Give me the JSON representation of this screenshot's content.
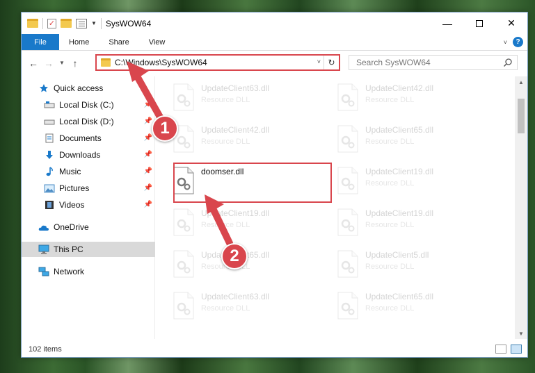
{
  "window": {
    "title": "SysWOW64"
  },
  "window_controls": {
    "minimize": "—",
    "maximize": "",
    "close": "✕"
  },
  "ribbon": {
    "tabs": [
      {
        "label": "File"
      },
      {
        "label": "Home"
      },
      {
        "label": "Share"
      },
      {
        "label": "View"
      }
    ]
  },
  "address": {
    "path": "C:\\Windows\\SysWOW64"
  },
  "search": {
    "placeholder": "Search SysWOW64"
  },
  "navigation": {
    "items": [
      {
        "label": "Quick access",
        "icon": "star-icon"
      },
      {
        "label": "Local Disk (C:)",
        "icon": "drive-icon",
        "pinned": true
      },
      {
        "label": "Local Disk (D:)",
        "icon": "drive-icon",
        "pinned": true
      },
      {
        "label": "Documents",
        "icon": "documents-icon",
        "pinned": true
      },
      {
        "label": "Downloads",
        "icon": "download-arrow-icon",
        "pinned": true
      },
      {
        "label": "Music",
        "icon": "music-note-icon",
        "pinned": true
      },
      {
        "label": "Pictures",
        "icon": "pictures-icon",
        "pinned": true
      },
      {
        "label": "Videos",
        "icon": "film-icon",
        "pinned": true
      },
      {
        "label": "OneDrive",
        "icon": "cloud-icon"
      },
      {
        "label": "This PC",
        "icon": "monitor-icon",
        "selected": true
      },
      {
        "label": "Network",
        "icon": "network-icon"
      }
    ]
  },
  "files": {
    "left": [
      {
        "name": "UpdateClient63.dll",
        "type": "Resource DLL",
        "faded": true
      },
      {
        "name": "UpdateClient42.dll",
        "type": "Resource DLL",
        "faded": true
      },
      {
        "name": "doomser.dll",
        "type": "",
        "faded": false,
        "highlighted": true
      },
      {
        "name": "UpdateClient19.dll",
        "type": "Resource DLL",
        "faded": true
      },
      {
        "name": "UpdateClient65.dll",
        "type": "Resource DLL",
        "faded": true
      },
      {
        "name": "UpdateClient63.dll",
        "type": "Resource DLL",
        "faded": true
      }
    ],
    "right": [
      {
        "name": "UpdateClient42.dll",
        "type": "Resource DLL",
        "faded": true
      },
      {
        "name": "UpdateClient65.dll",
        "type": "Resource DLL",
        "faded": true
      },
      {
        "name": "UpdateClient19.dll",
        "type": "Resource DLL",
        "faded": true
      },
      {
        "name": "UpdateClient19.dll",
        "type": "Resource DLL",
        "faded": true
      },
      {
        "name": "UpdateClient5.dll",
        "type": "Resource DLL",
        "faded": true
      },
      {
        "name": "UpdateClient65.dll",
        "type": "Resource DLL",
        "faded": true
      }
    ]
  },
  "status": {
    "item_count": "102 items"
  },
  "annotations": {
    "step1": "1",
    "step2": "2",
    "color": "#d9464d"
  }
}
